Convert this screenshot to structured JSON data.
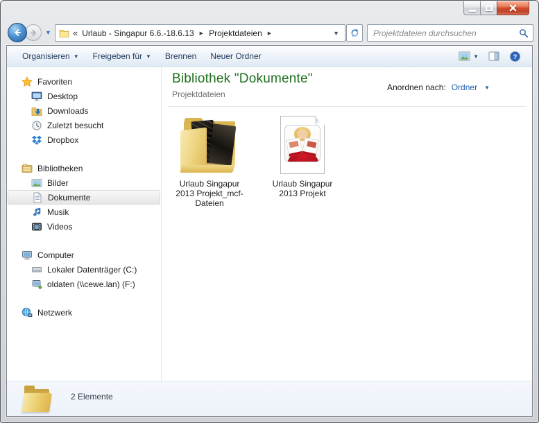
{
  "window": {
    "caption_buttons": [
      {
        "icon": "minimize-icon"
      },
      {
        "icon": "maximize-icon"
      },
      {
        "icon": "close-icon"
      }
    ]
  },
  "nav": {
    "back_icon": "back-arrow-icon",
    "forward_icon": "forward-arrow-icon",
    "breadcrumb": {
      "icon": "folder-icon",
      "overflow": "«",
      "items": [
        {
          "label": "Urlaub - Singapur 6.6.-18.6.13"
        },
        {
          "label": "Projektdateien"
        }
      ]
    },
    "search": {
      "placeholder": "Projektdateien durchsuchen",
      "icon": "magnifier-icon"
    }
  },
  "toolbar": {
    "items": [
      {
        "label": "Organisieren",
        "has_menu": true
      },
      {
        "label": "Freigeben für",
        "has_menu": true
      },
      {
        "label": "Brennen",
        "has_menu": false
      },
      {
        "label": "Neuer Ordner",
        "has_menu": false
      }
    ],
    "right_icons": [
      "views-icon",
      "preview-pane-icon",
      "help-icon"
    ]
  },
  "sidebar": {
    "sections": [
      {
        "label": "Favoriten",
        "icon": "star-icon",
        "items": [
          {
            "label": "Desktop",
            "icon": "desktop-icon"
          },
          {
            "label": "Downloads",
            "icon": "downloads-icon"
          },
          {
            "label": "Zuletzt besucht",
            "icon": "recent-places-icon"
          },
          {
            "label": "Dropbox",
            "icon": "dropbox-icon"
          }
        ]
      },
      {
        "label": "Bibliotheken",
        "icon": "libraries-icon",
        "items": [
          {
            "label": "Bilder",
            "icon": "pictures-icon"
          },
          {
            "label": "Dokumente",
            "icon": "documents-icon",
            "selected": true
          },
          {
            "label": "Musik",
            "icon": "music-icon"
          },
          {
            "label": "Videos",
            "icon": "videos-icon"
          }
        ]
      },
      {
        "label": "Computer",
        "icon": "computer-icon",
        "items": [
          {
            "label": "Lokaler Datenträger (C:)",
            "icon": "hdd-icon"
          },
          {
            "label": "oldaten (\\\\cewe.lan) (F:)",
            "icon": "network-drive-icon"
          }
        ]
      },
      {
        "label": "Netzwerk",
        "icon": "network-icon",
        "items": []
      }
    ]
  },
  "main": {
    "header": {
      "title": "Bibliothek \"Dokumente\"",
      "subtitle": "Projektdateien",
      "arrange_label": "Anordnen nach:",
      "arrange_value": "Ordner"
    },
    "items": [
      {
        "name": "Urlaub Singapur 2013 Projekt_mcf-Dateien",
        "type": "folder",
        "icon": "folder-with-photos-icon"
      },
      {
        "name": "Urlaub Singapur 2013 Projekt",
        "type": "cewe-project-file",
        "icon": "photobook-file-icon"
      }
    ]
  },
  "statusbar": {
    "count_text": "2 Elemente",
    "icon": "folder-icon"
  },
  "colors": {
    "library_title_green": "#1d6f1d",
    "link_blue": "#2161b0",
    "toolbar_text": "#1e395b",
    "close_button_red": "#cf4b2f"
  }
}
